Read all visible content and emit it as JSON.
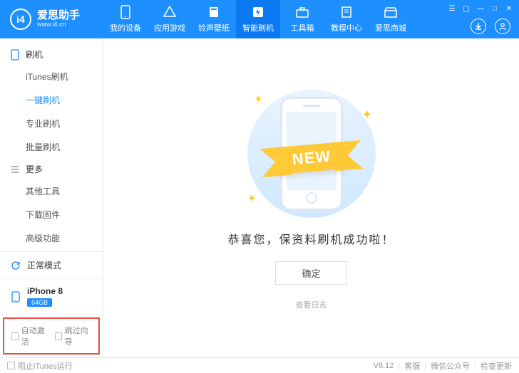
{
  "brand": {
    "logo_letters": "i4",
    "title": "爱思助手",
    "subtitle": "www.i4.cn"
  },
  "nav": {
    "items": [
      {
        "label": "我的设备",
        "icon": "phone"
      },
      {
        "label": "应用游戏",
        "icon": "apps"
      },
      {
        "label": "铃声壁纸",
        "icon": "music"
      },
      {
        "label": "智能刷机",
        "icon": "flash"
      },
      {
        "label": "工具箱",
        "icon": "toolbox"
      },
      {
        "label": "教程中心",
        "icon": "book"
      },
      {
        "label": "爱思商城",
        "icon": "shop"
      }
    ],
    "active_index": 3
  },
  "sidebar": {
    "sections": [
      {
        "title": "刷机",
        "items": [
          "iTunes刷机",
          "一键刷机",
          "专业刷机",
          "批量刷机"
        ],
        "active_index": 1
      },
      {
        "title": "更多",
        "items": [
          "其他工具",
          "下载固件",
          "高级功能"
        ],
        "active_index": -1
      }
    ],
    "mode": {
      "label": "正常模式"
    },
    "device": {
      "name": "iPhone 8",
      "storage": "64GB"
    },
    "checks": {
      "auto_activate": "自动激活",
      "skip_guide": "跳过向导"
    }
  },
  "main": {
    "ribbon_text": "NEW",
    "success": "恭喜您，保资料刷机成功啦！",
    "ok_button": "确定",
    "log_link": "查看日志"
  },
  "footer": {
    "block_itunes": "阻止iTunes运行",
    "version": "V8.12",
    "links": [
      "客服",
      "微信公众号",
      "检查更新"
    ]
  }
}
